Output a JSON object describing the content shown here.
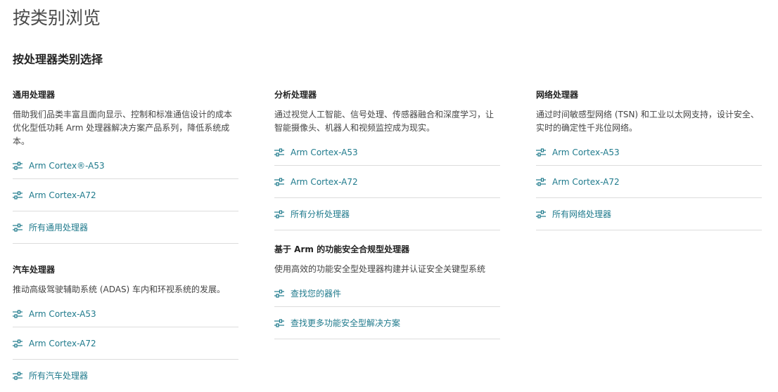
{
  "page": {
    "title": "按类别浏览",
    "section_title": "按处理器类别选择"
  },
  "colors": {
    "link": "#1f7a8c",
    "divider": "#dcdcdc",
    "heading": "#222222"
  },
  "columns": [
    {
      "groups": [
        {
          "title": "通用处理器",
          "description": "借助我们品类丰富且面向显示、控制和标准通信设计的成本优化型低功耗 Arm 处理器解决方案产品系列，降低系统成本。",
          "links": [
            {
              "label": "Arm Cortex®-A53",
              "icon": "sliders-icon"
            },
            {
              "label": "Arm Cortex-A72",
              "icon": "sliders-icon"
            },
            {
              "label": "所有通用处理器",
              "icon": "sliders-icon"
            }
          ]
        },
        {
          "title": "汽车处理器",
          "description": "推动高级驾驶辅助系统 (ADAS) 车内和环视系统的发展。",
          "links": [
            {
              "label": "Arm Cortex-A53",
              "icon": "sliders-icon"
            },
            {
              "label": "Arm Cortex-A72",
              "icon": "sliders-icon"
            },
            {
              "label": "所有汽车处理器",
              "icon": "sliders-icon"
            }
          ]
        }
      ]
    },
    {
      "groups": [
        {
          "title": "分析处理器",
          "description": "通过视觉人工智能、信号处理、传感器融合和深度学习，让智能摄像头、机器人和视频监控成为现实。",
          "links": [
            {
              "label": "Arm Cortex-A53",
              "icon": "sliders-icon"
            },
            {
              "label": "Arm Cortex-A72",
              "icon": "sliders-icon"
            },
            {
              "label": "所有分析处理器",
              "icon": "sliders-icon"
            }
          ]
        },
        {
          "title": "基于 Arm 的功能安全合规型处理器",
          "description": "使用高效的功能安全型处理器构建并认证安全关键型系统",
          "links": [
            {
              "label": "查找您的器件",
              "icon": "sliders-icon"
            },
            {
              "label": "查找更多功能安全型解决方案",
              "icon": "sliders-icon"
            }
          ]
        }
      ]
    },
    {
      "groups": [
        {
          "title": "网络处理器",
          "description": "通过时间敏感型网络 (TSN) 和工业以太网支持，设计安全、实时的确定性千兆位网络。",
          "links": [
            {
              "label": "Arm Cortex-A53",
              "icon": "sliders-icon"
            },
            {
              "label": "Arm Cortex-A72",
              "icon": "sliders-icon"
            },
            {
              "label": "所有网络处理器",
              "icon": "sliders-icon"
            }
          ]
        }
      ]
    }
  ]
}
